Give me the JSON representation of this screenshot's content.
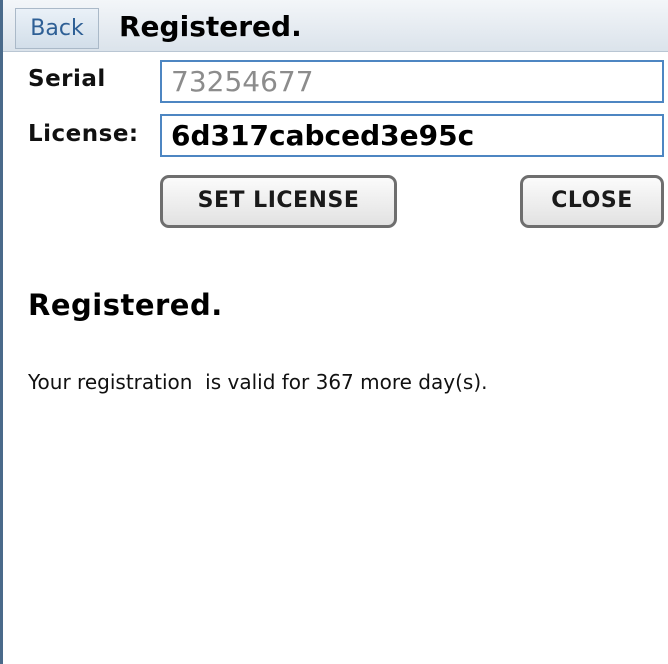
{
  "header": {
    "back_label": "Back",
    "title": "Registered."
  },
  "form": {
    "serial_label": "Serial",
    "serial_value": "73254677",
    "license_label": "License:",
    "license_value": "6d317cabced3e95c"
  },
  "buttons": {
    "set_license_label": "SET LICENSE",
    "close_label": "CLOSE"
  },
  "status": {
    "heading": "Registered.",
    "message": "Your registration  is valid for 367 more day(s)."
  },
  "colors": {
    "accent": "#4d86c2",
    "back_text": "#2e5f95",
    "titlebar": "#dbe3eb"
  }
}
